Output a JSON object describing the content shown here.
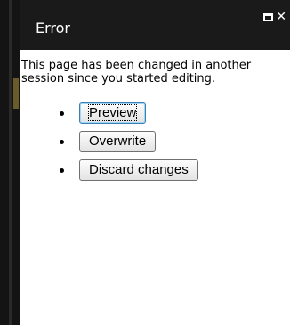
{
  "dialog": {
    "title": "Error",
    "message": "This page has been changed in another session since you started editing.",
    "icons": {
      "maximize": "maximize-icon",
      "close": "close-icon"
    }
  },
  "actions": [
    {
      "label": "Preview",
      "focused": true
    },
    {
      "label": "Overwrite",
      "focused": false
    },
    {
      "label": "Discard changes",
      "focused": false
    }
  ]
}
